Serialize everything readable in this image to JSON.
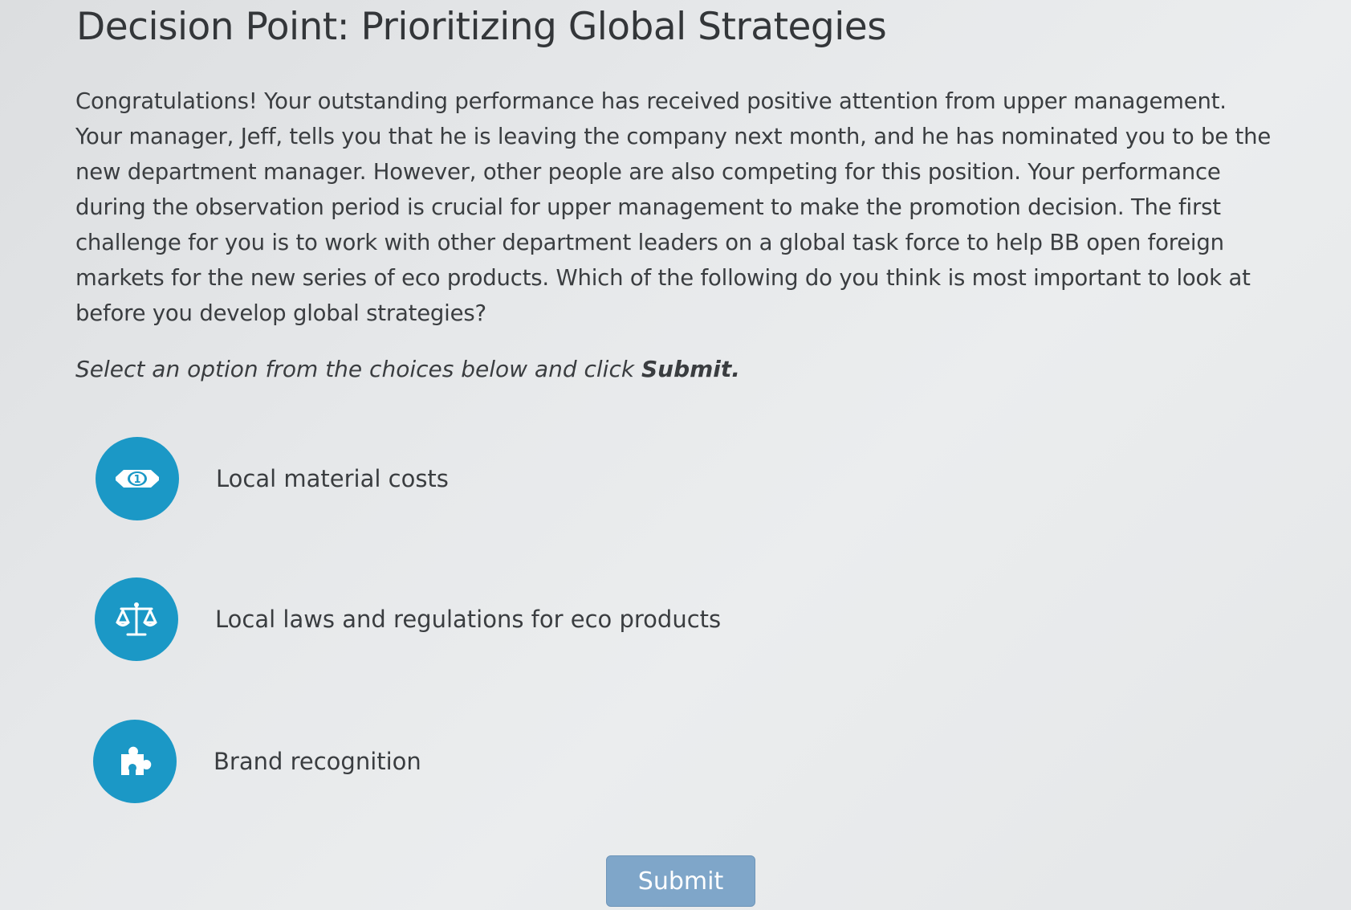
{
  "title": "Decision Point: Prioritizing Global Strategies",
  "intro": "Congratulations! Your outstanding performance has received positive attention from upper management. Your manager, Jeff, tells you that he is leaving the company next month, and he has nominated you to be the new department manager. However, other people are also competing for this position. Your performance during the observation period is crucial for upper management to make the promotion decision. The first challenge for you is to work with other department leaders on a global task force to help BB open foreign markets for the new series of eco products. Which of the following do you think is most important to look at before you develop global strategies?",
  "instruction": {
    "prefix": "Select an option from the choices below and click ",
    "emphasis": "Submit."
  },
  "options": [
    {
      "label": "Local material costs",
      "icon": "money-bill-icon"
    },
    {
      "label": "Local laws and regulations for eco products",
      "icon": "scales-icon"
    },
    {
      "label": "Brand recognition",
      "icon": "puzzle-piece-icon"
    }
  ],
  "submit_label": "Submit",
  "colors": {
    "accent": "#1b98c6",
    "button": "#7fa6c9",
    "text": "#3a3d40"
  }
}
